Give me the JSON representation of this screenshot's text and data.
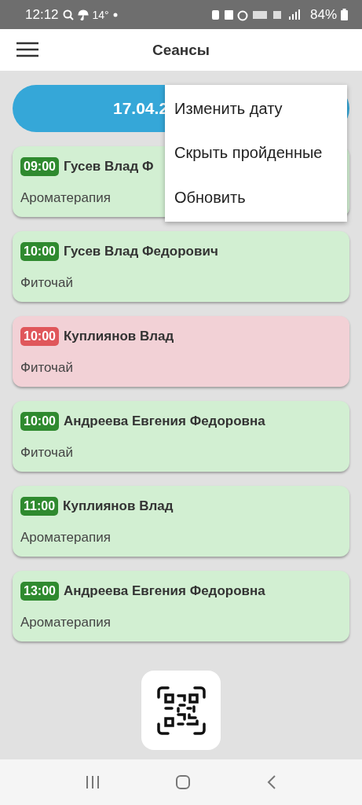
{
  "status_bar": {
    "time": "12:12",
    "temperature": "14°",
    "battery": "84%"
  },
  "app_bar": {
    "title": "Сеансы"
  },
  "date_button": {
    "label": "17.04.2"
  },
  "menu": [
    {
      "label": "Изменить дату"
    },
    {
      "label": "Скрыть пройденные"
    },
    {
      "label": "Обновить"
    }
  ],
  "sessions": [
    {
      "time": "09:00",
      "name": "Гусев Влад Ф",
      "service": "Ароматерапия",
      "kind": "ok"
    },
    {
      "time": "10:00",
      "name": "Гусев Влад Федорович",
      "service": "Фиточай",
      "kind": "ok"
    },
    {
      "time": "10:00",
      "name": "Куплиянов Влад",
      "service": "Фиточай",
      "kind": "missed"
    },
    {
      "time": "10:00",
      "name": "Андреева Евгения Федоровна",
      "service": "Фиточай",
      "kind": "ok"
    },
    {
      "time": "11:00",
      "name": "Куплиянов Влад",
      "service": "Ароматерапия",
      "kind": "ok"
    },
    {
      "time": "13:00",
      "name": "Андреева Евгения Федоровна",
      "service": "Ароматерапия",
      "kind": "ok"
    }
  ]
}
